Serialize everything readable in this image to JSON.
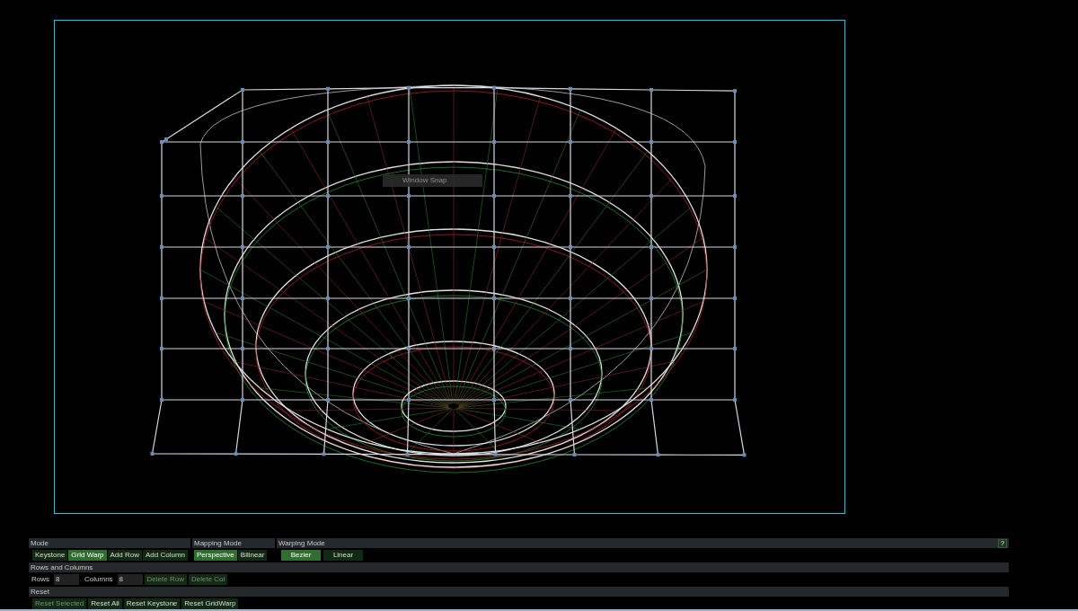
{
  "viewport": {
    "tooltip": "Window Snap"
  },
  "sections": [
    {
      "title": "Mode",
      "buttons": [
        {
          "label": "Keystone",
          "selected": false
        },
        {
          "label": "Grid Warp",
          "selected": true
        },
        {
          "label": "Add Row",
          "selected": false
        },
        {
          "label": "Add Column",
          "selected": false
        }
      ]
    },
    {
      "title": "Mapping Mode",
      "buttons": [
        {
          "label": "Perspective",
          "selected": true
        },
        {
          "label": "Bilinear",
          "selected": false
        }
      ]
    },
    {
      "title": "Warping Mode",
      "help": "?",
      "buttons": [
        {
          "label": "Bezier",
          "selected": true
        },
        {
          "label": "Linear",
          "selected": false
        }
      ]
    }
  ],
  "rows_and_columns": {
    "title": "Rows and Columns",
    "rows_label": "Rows",
    "rows_value": "8",
    "columns_label": "Columns",
    "columns_value": "8",
    "buttons": [
      {
        "label": "Delete Row",
        "disabled": true
      },
      {
        "label": "Delete Col",
        "disabled": true
      }
    ]
  },
  "reset": {
    "title": "Reset",
    "buttons": [
      {
        "label": "Reset Selected",
        "disabled": true
      },
      {
        "label": "Reset All",
        "disabled": false
      },
      {
        "label": "Reset Keystone",
        "disabled": false
      },
      {
        "label": "Reset GridWarp",
        "disabled": false
      }
    ]
  }
}
